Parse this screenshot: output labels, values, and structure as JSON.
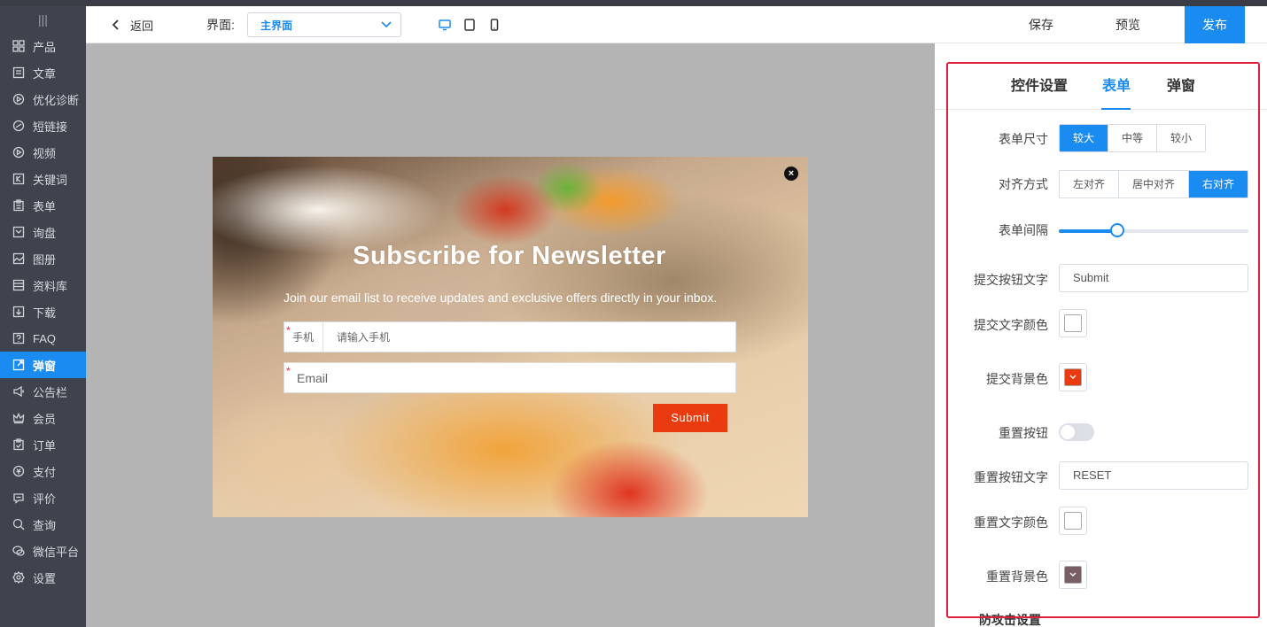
{
  "sidebar": {
    "items": [
      {
        "label": "产品",
        "icon": "grid-icon"
      },
      {
        "label": "文章",
        "icon": "article-icon"
      },
      {
        "label": "优化诊断",
        "icon": "diagnose-icon"
      },
      {
        "label": "短链接",
        "icon": "link-icon"
      },
      {
        "label": "视频",
        "icon": "video-icon"
      },
      {
        "label": "关键词",
        "icon": "keyword-icon"
      },
      {
        "label": "表单",
        "icon": "form-icon"
      },
      {
        "label": "询盘",
        "icon": "inquiry-icon"
      },
      {
        "label": "图册",
        "icon": "album-icon"
      },
      {
        "label": "资料库",
        "icon": "library-icon"
      },
      {
        "label": "下载",
        "icon": "download-icon"
      },
      {
        "label": "FAQ",
        "icon": "faq-icon"
      },
      {
        "label": "弹窗",
        "icon": "popup-icon",
        "active": true
      },
      {
        "label": "公告栏",
        "icon": "megaphone-icon"
      },
      {
        "label": "会员",
        "icon": "crown-icon"
      },
      {
        "label": "订单",
        "icon": "order-icon"
      },
      {
        "label": "支付",
        "icon": "payment-icon"
      },
      {
        "label": "评价",
        "icon": "comment-icon"
      },
      {
        "label": "查询",
        "icon": "search-icon"
      },
      {
        "label": "微信平台",
        "icon": "wechat-icon"
      },
      {
        "label": "设置",
        "icon": "gear-icon"
      }
    ]
  },
  "header": {
    "back_label": "返回",
    "interface_label": "界面:",
    "interface_value": "主界面",
    "save_label": "保存",
    "preview_label": "预览",
    "publish_label": "发布"
  },
  "popup": {
    "title": "Subscribe for Newsletter",
    "description": "Join our email list to receive updates and exclusive offers directly in your inbox.",
    "phone_label": "手机",
    "phone_placeholder": "请输入手机",
    "email_placeholder": "Email",
    "required_mark": "*",
    "submit_label": "Submit",
    "close_glyph": "×"
  },
  "panel": {
    "tabs": [
      "控件设置",
      "表单",
      "弹窗"
    ],
    "active_tab": 1,
    "form_size": {
      "label": "表单尺寸",
      "options": [
        "较大",
        "中等",
        "较小"
      ],
      "selected": 0
    },
    "alignment": {
      "label": "对齐方式",
      "options": [
        "左对齐",
        "居中对齐",
        "右对齐"
      ],
      "selected": 2
    },
    "spacing": {
      "label": "表单间隔",
      "value_fraction": 0.31
    },
    "submit_text": {
      "label": "提交按钮文字",
      "value": "Submit"
    },
    "submit_text_color": {
      "label": "提交文字颜色",
      "color": "#ffffff"
    },
    "submit_bg_color": {
      "label": "提交背景色",
      "color": "#ea3b10"
    },
    "reset_button": {
      "label": "重置按钮",
      "enabled": false
    },
    "reset_text": {
      "label": "重置按钮文字",
      "value": "RESET"
    },
    "reset_text_color": {
      "label": "重置文字颜色",
      "color": "#ffffff"
    },
    "reset_bg_color": {
      "label": "重置背景色",
      "color": "#7a5e66"
    },
    "next_section": "防攻击设置"
  },
  "colors": {
    "accent": "#1a8bf0",
    "sidebar_bg": "#3f434d",
    "highlight_border": "#e0203a"
  }
}
